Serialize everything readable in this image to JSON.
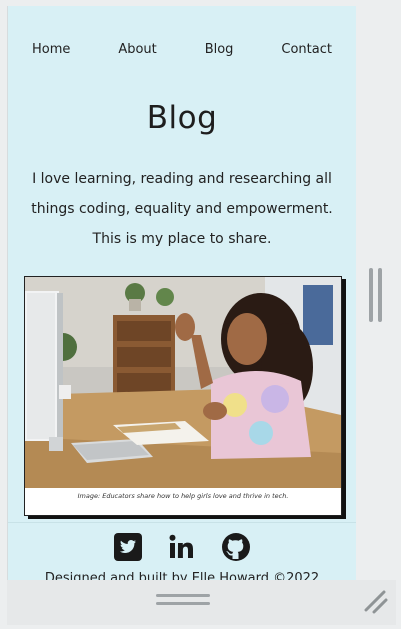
{
  "nav": {
    "items": [
      {
        "label": "Home"
      },
      {
        "label": "About"
      },
      {
        "label": "Blog"
      },
      {
        "label": "Contact"
      }
    ]
  },
  "page": {
    "title": "Blog",
    "intro": "I love learning, reading and researching all things coding, equality and empowerment. This is my place to share."
  },
  "card": {
    "caption": "Image: Educators share how to help girls love and thrive in tech."
  },
  "social": {
    "icons": [
      "twitter-icon",
      "linkedin-icon",
      "github-icon"
    ]
  },
  "footer": {
    "text": "Designed and built by Elle Howard ©2022"
  },
  "colors": {
    "page_bg": "#d8f0f5",
    "chrome_bg": "#eceeef",
    "text": "#222222"
  }
}
